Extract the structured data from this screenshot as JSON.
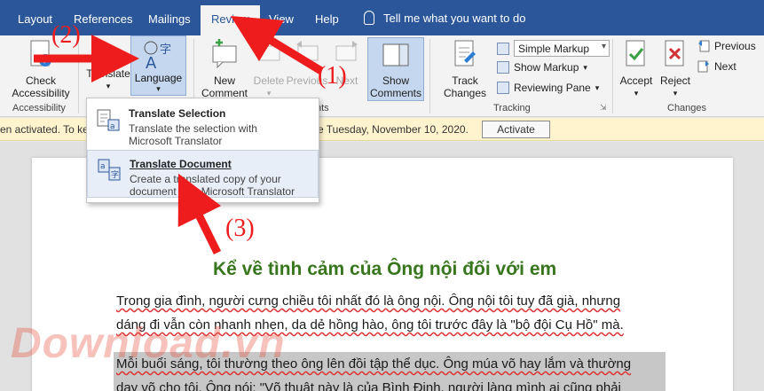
{
  "tabs": [
    {
      "label": "Layout"
    },
    {
      "label": "References"
    },
    {
      "label": "Mailings"
    },
    {
      "label": "Review"
    },
    {
      "label": "View"
    },
    {
      "label": "Help"
    }
  ],
  "tell_me": "Tell me what you want to do",
  "ribbon": {
    "check_accessibility": [
      "Check",
      "Accessibility"
    ],
    "accessibility_group": "Accessibility",
    "translate": "Translate",
    "language": "Language",
    "new_comment": [
      "New",
      "Comment"
    ],
    "delete": "Delete",
    "previous": "Previous",
    "next": "Next",
    "show_comments": [
      "Show",
      "Comments"
    ],
    "comments_group_tail": "nts",
    "track_changes": [
      "Track",
      "Changes"
    ],
    "simple_markup": "Simple Markup",
    "show_markup": "Show Markup",
    "reviewing_pane": "Reviewing Pane",
    "tracking_group": "Tracking",
    "accept": "Accept",
    "reject": "Reject",
    "changes_previous": "Previous",
    "changes_next": "Next",
    "changes_group": "Changes"
  },
  "dropdown": {
    "translate_selection": {
      "title": "Translate Selection",
      "desc1": "Translate the selection with",
      "desc2": "Microsoft Translator"
    },
    "translate_document": {
      "title": "Translate Document",
      "desc1": "Create a translated copy of your",
      "desc2": "document with Microsoft Translator"
    }
  },
  "message_bar": {
    "text_left": "en activated. To kee",
    "text_right": "e Tuesday, November 10, 2020.",
    "activate": "Activate"
  },
  "document": {
    "title": "Kể về tình cảm của Ông nội đối với em",
    "lines": [
      "Trong gia đình, người cưng chiều tôi nhất đó là ông nội. Ông nội tôi tuy đã già, nhưng",
      "dáng đi vẫn còn nhanh nhẹn, da dẻ hồng hào, ông tôi trước đây là \"bộ đội Cụ Hồ\" mà.",
      "Mỗi buổi sáng, tôi thường theo ông lên đồi tập thể dục. Ông múa võ hay lắm và thường",
      "dạy võ cho tôi. Ông nói: \"Võ thuật này là của Bình Định, người làng mình ai cũng phải"
    ]
  },
  "annotations": [
    "(1)",
    "(2)",
    "(3)"
  ],
  "watermark": "Download.vn",
  "colors": {
    "ribbon_blue": "#2b579a",
    "arrow_red": "#ee1c1c",
    "title_green": "#38761d"
  }
}
